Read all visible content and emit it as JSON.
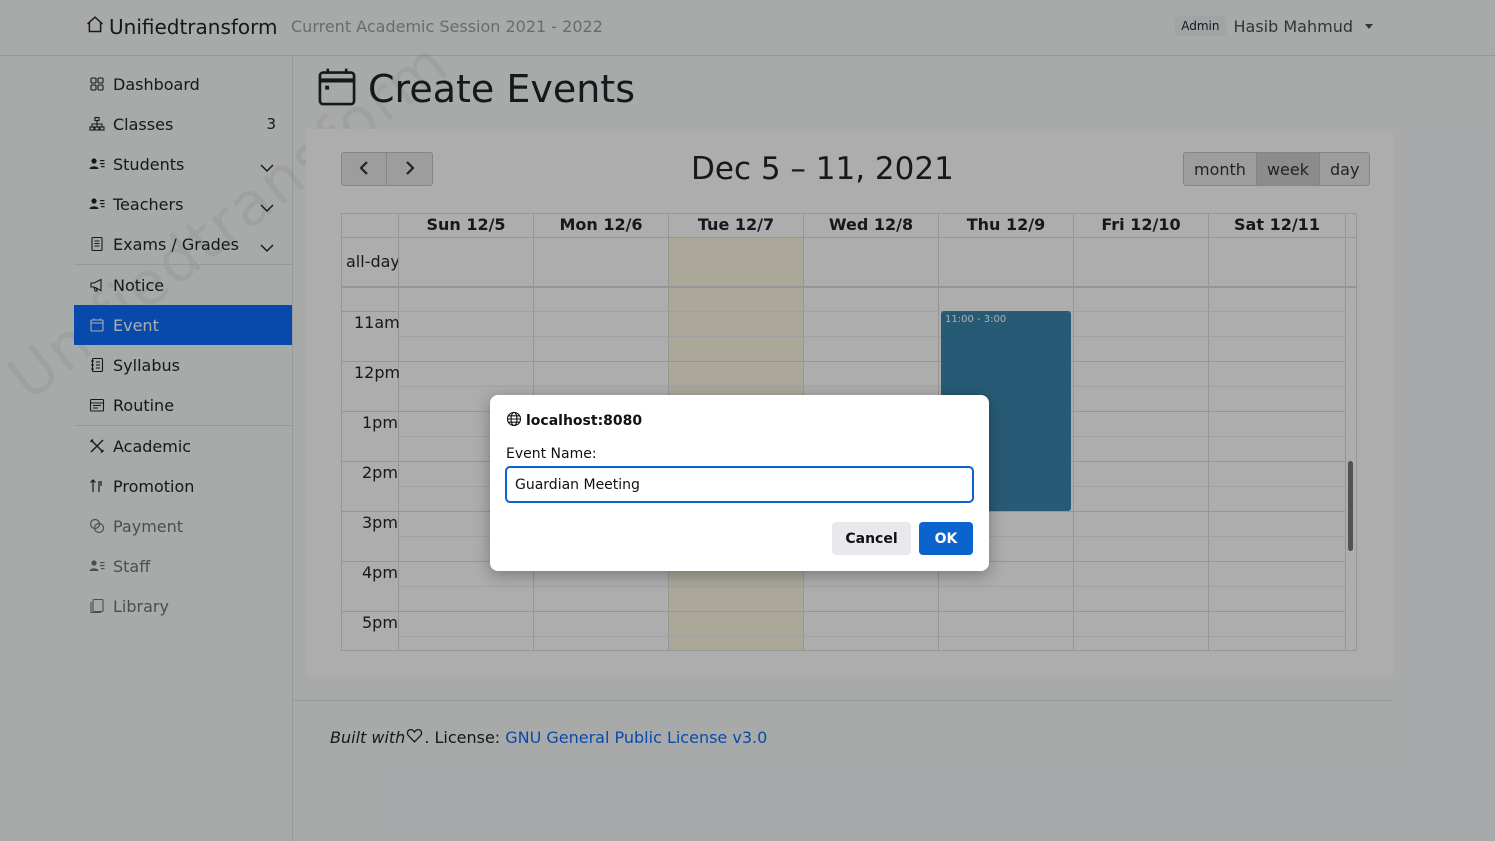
{
  "navbar": {
    "brand": "Unifiedtransform",
    "session": "Current Academic Session 2021 - 2022",
    "role": "Admin",
    "user": "Hasib Mahmud"
  },
  "sidebar": {
    "watermark": "Unifiedtransform",
    "items": [
      {
        "label": "Dashboard",
        "icon": "grid-icon"
      },
      {
        "label": "Classes",
        "icon": "diagram-icon",
        "count": "3"
      },
      {
        "label": "Students",
        "icon": "person-lines-icon"
      },
      {
        "label": "Teachers",
        "icon": "person-lines-icon"
      },
      {
        "label": "Exams / Grades",
        "icon": "file-text-icon"
      },
      {
        "label": "Notice",
        "icon": "megaphone-icon"
      },
      {
        "label": "Event",
        "icon": "calendar-icon"
      },
      {
        "label": "Syllabus",
        "icon": "journal-icon"
      },
      {
        "label": "Routine",
        "icon": "calendar-table-icon"
      },
      {
        "label": "Academic",
        "icon": "tools-icon"
      },
      {
        "label": "Promotion",
        "icon": "sort-icon"
      },
      {
        "label": "Payment",
        "icon": "cash-icon"
      },
      {
        "label": "Staff",
        "icon": "person-lines-icon"
      },
      {
        "label": "Library",
        "icon": "journals-icon"
      }
    ]
  },
  "page": {
    "title": "Create Events"
  },
  "calendar": {
    "title": "Dec 5 – 11, 2021",
    "prev": "‹",
    "next": "›",
    "views": [
      "month",
      "week",
      "day"
    ],
    "active_view": "week",
    "days": [
      "Sun 12/5",
      "Mon 12/6",
      "Tue 12/7",
      "Wed 12/8",
      "Thu 12/9",
      "Fri 12/10",
      "Sat 12/11"
    ],
    "allday_label": "all-day",
    "times": [
      "11am",
      "12pm",
      "1pm",
      "2pm",
      "3pm",
      "4pm",
      "5pm"
    ],
    "event": {
      "time": "11:00 - 3:00",
      "day": "Thu 12/9"
    }
  },
  "footer": {
    "built_with": "Built with",
    "license_prefix": ". License:",
    "license_link": "GNU General Public License v3.0"
  },
  "dialog": {
    "origin": "localhost:8080",
    "label": "Event Name:",
    "value": "Guardian Meeting",
    "cancel": "Cancel",
    "ok": "OK"
  },
  "colors": {
    "primary": "#0d6efd",
    "event": "#3a87ad",
    "today": "#fcf8e3",
    "dialog_accent": "#0b63ce"
  }
}
